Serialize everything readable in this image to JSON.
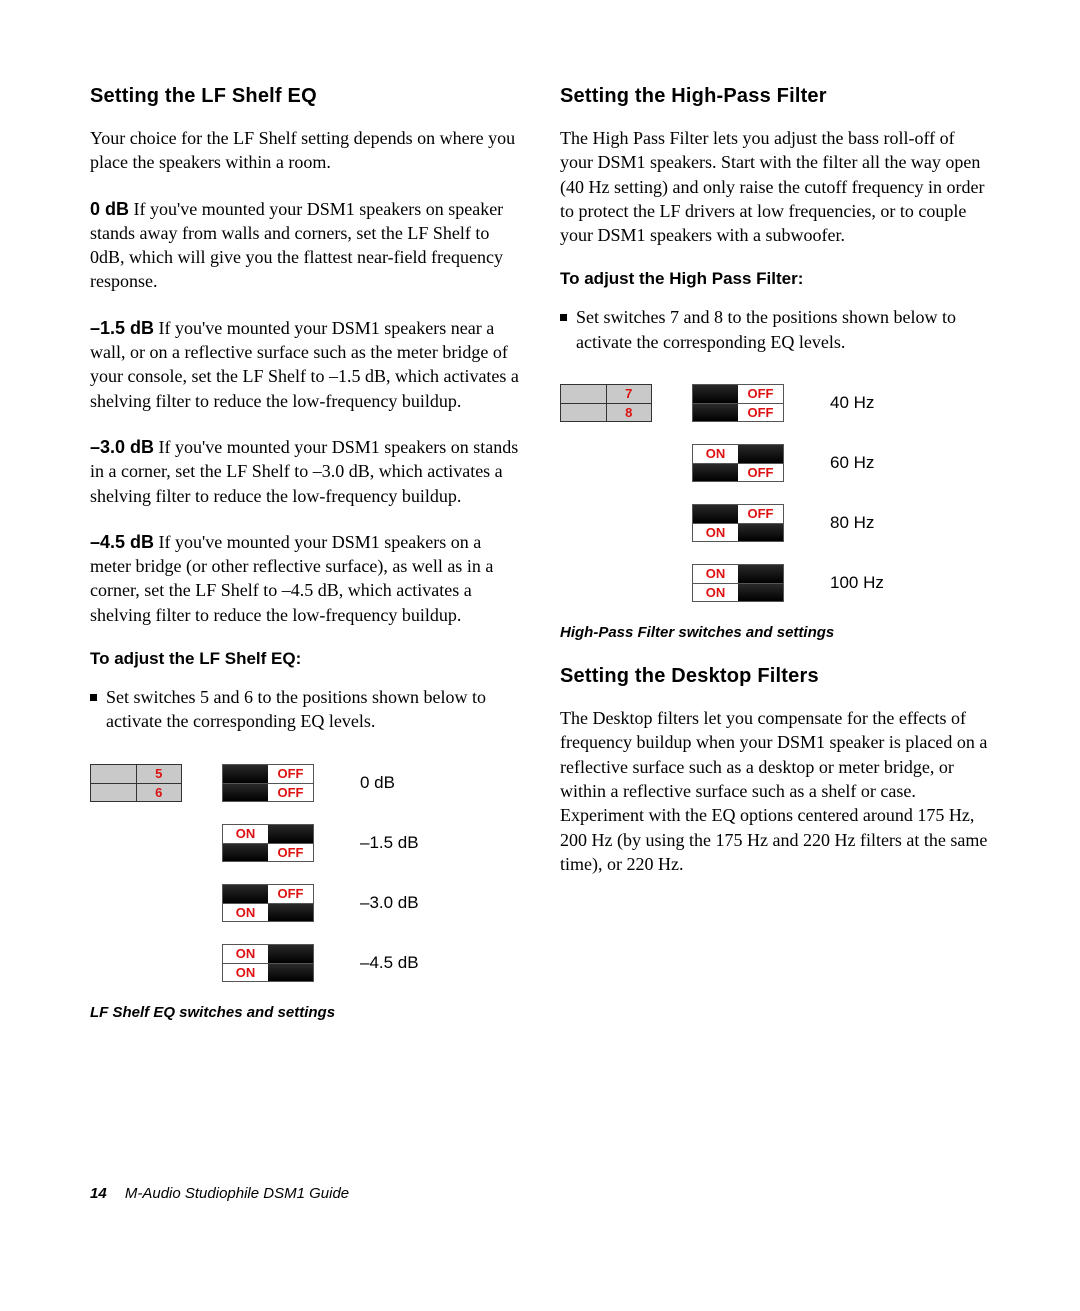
{
  "left": {
    "heading": "Setting the LF Shelf EQ",
    "intro": "Your choice for the LF Shelf setting depends on where you place the speakers within a room.",
    "items": [
      {
        "lead": "0 dB",
        "text": " If you've mounted your DSM1 speakers on speaker stands away from walls and corners, set the LF Shelf to 0dB, which will give you the flattest near-field frequency response."
      },
      {
        "lead": "–1.5 dB",
        "text": " If you've mounted your DSM1 speakers near a wall, or on a reflective surface such as the meter bridge of your console, set the LF Shelf to –1.5 dB, which activates a shelving filter to reduce the low-frequency buildup."
      },
      {
        "lead": "–3.0 dB",
        "text": " If you've mounted your DSM1 speakers on stands in a corner, set the LF Shelf to –3.0 dB, which activates a shelving filter to reduce the low-frequency buildup."
      },
      {
        "lead": "–4.5 dB",
        "text": " If you've mounted your DSM1 speakers on a meter bridge (or other reflective surface), as well as in a corner, set the LF Shelf to –4.5 dB, which activates a shelving filter to reduce the low-frequency buildup."
      }
    ],
    "subhead": "To adjust the LF Shelf EQ:",
    "bullet": "Set switches 5 and 6 to the positions shown below to activate the corresponding EQ levels.",
    "key_labels": [
      "5",
      "6"
    ],
    "rows": [
      {
        "sw": [
          "OFF",
          "OFF"
        ],
        "value": "0 dB"
      },
      {
        "sw": [
          "ON",
          "OFF"
        ],
        "value": "–1.5 dB"
      },
      {
        "sw": [
          "OFF",
          "ON"
        ],
        "value": "–3.0 dB"
      },
      {
        "sw": [
          "ON",
          "ON"
        ],
        "value": "–4.5 dB"
      }
    ],
    "caption": "LF Shelf EQ switches and settings"
  },
  "right": {
    "heading": "Setting the High-Pass Filter",
    "intro": "The High Pass Filter lets you adjust the bass roll-off of your DSM1 speakers. Start with the filter all the way open (40 Hz setting) and only raise the cutoff frequency in order to protect the LF drivers at low frequencies, or to couple your DSM1 speakers with a subwoofer.",
    "subhead": "To adjust the High Pass Filter:",
    "bullet": "Set switches 7 and 8 to the positions shown below to activate the corresponding EQ levels.",
    "key_labels": [
      "7",
      "8"
    ],
    "rows": [
      {
        "sw": [
          "OFF",
          "OFF"
        ],
        "value": "40 Hz"
      },
      {
        "sw": [
          "ON",
          "OFF"
        ],
        "value": "60 Hz"
      },
      {
        "sw": [
          "OFF",
          "ON"
        ],
        "value": "80 Hz"
      },
      {
        "sw": [
          "ON",
          "ON"
        ],
        "value": "100 Hz"
      }
    ],
    "caption": "High-Pass Filter switches and settings",
    "heading2": "Setting the Desktop Filters",
    "body2": "The Desktop filters let you compensate for the effects of frequency buildup when your DSM1 speaker is placed on a reflective surface such as a desktop or meter bridge, or within a reflective surface such as a shelf or case. Experiment with the EQ options centered around 175 Hz, 200 Hz (by using the 175 Hz and 220 Hz filters at the same time), or 220 Hz."
  },
  "footer": {
    "page": "14",
    "title": "M-Audio Studiophile DSM1 Guide"
  },
  "labels": {
    "on": "ON",
    "off": "OFF"
  }
}
